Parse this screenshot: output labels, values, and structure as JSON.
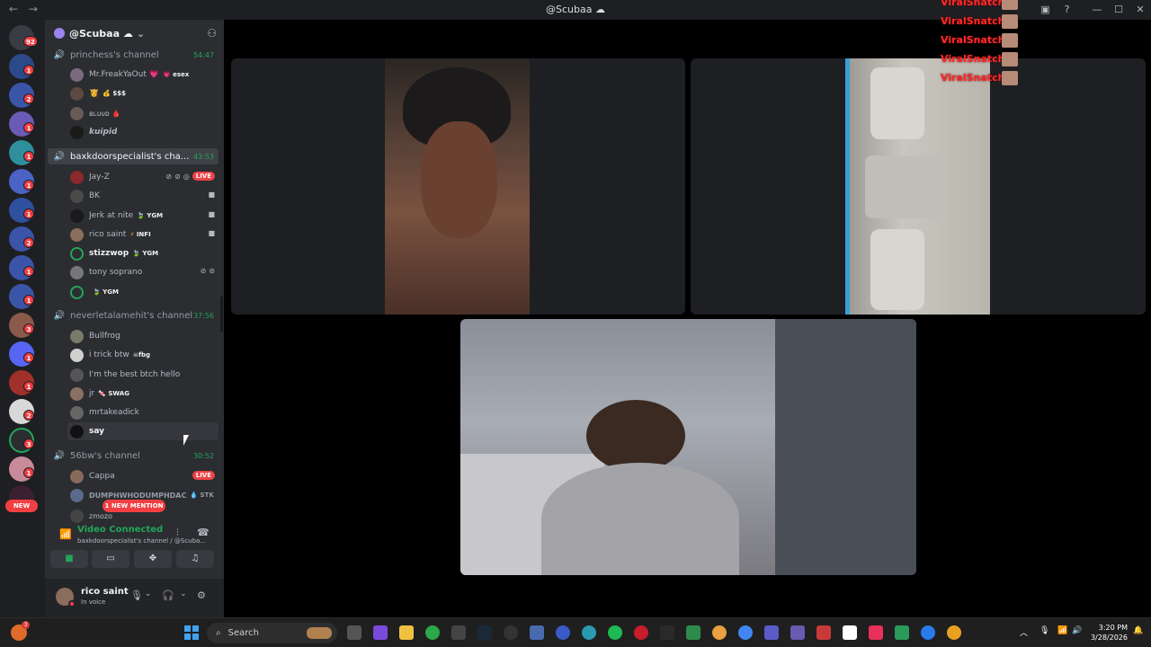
{
  "window": {
    "title": "@Scubaa ☁",
    "nav_back": "←",
    "nav_forward": "→"
  },
  "server_rail": {
    "home_badge": "92",
    "badges": [
      "1",
      "2",
      "1",
      "1",
      "1",
      "1",
      "2",
      "1",
      "1",
      "3",
      "1",
      "1",
      "2",
      "3",
      "1"
    ],
    "new_label": "NEW"
  },
  "server": {
    "name": "@Scubaa ☁"
  },
  "channels": [
    {
      "name": "princhess's channel",
      "duration": "54:47",
      "users": [
        {
          "name": "Mr.FreakYaOut 💗",
          "tag": "esex",
          "tag_emoji": "💗"
        },
        {
          "name": "👸",
          "tag": "$$$",
          "tag_emoji": "💰"
        },
        {
          "name": "ʙʟᴜᴜᴅ 🩸",
          "tag": "",
          "tag_emoji": ""
        },
        {
          "name": "kuipid",
          "tag": "",
          "tag_emoji": ""
        }
      ]
    },
    {
      "name": "baxkdoorspecialist's cha...",
      "duration": "43:53",
      "users": [
        {
          "name": "Jay-Z",
          "tag": "",
          "tag_emoji": "",
          "live": "LIVE"
        },
        {
          "name": "BK",
          "tag": "",
          "tag_emoji": ""
        },
        {
          "name": "Jerk at nite",
          "tag": "YGM",
          "tag_emoji": "🍃"
        },
        {
          "name": "rico saint",
          "tag": "INFI",
          "tag_emoji": "⚡"
        },
        {
          "name": "stizzwop",
          "tag": "YGM",
          "tag_emoji": "🍃"
        },
        {
          "name": "tony soprano",
          "tag": "",
          "tag_emoji": ""
        },
        {
          "name": "",
          "tag": "YGM",
          "tag_emoji": "🍃"
        }
      ]
    },
    {
      "name": "neverletalamehit's channel",
      "duration": "37:56",
      "users": [
        {
          "name": "Bullfrog",
          "tag": "",
          "tag_emoji": ""
        },
        {
          "name": "i trick btw",
          "tag": "fbg",
          "tag_emoji": "☠"
        },
        {
          "name": "I'm the best btch hello",
          "tag": "",
          "tag_emoji": ""
        },
        {
          "name": "jr",
          "tag": "SWAG",
          "tag_emoji": "🍬"
        },
        {
          "name": "mrtakeadick",
          "tag": "",
          "tag_emoji": ""
        },
        {
          "name": "say",
          "tag": "",
          "tag_emoji": ""
        }
      ]
    },
    {
      "name": "56bw's channel",
      "duration": "30:52",
      "users": [
        {
          "name": "Cappa",
          "tag": "",
          "tag_emoji": "",
          "live": "LIVE"
        },
        {
          "name": "DUMPHWHODUMPHDAC",
          "tag": "STK",
          "tag_emoji": "💧"
        },
        {
          "name": "zmozo",
          "tag": "",
          "tag_emoji": ""
        }
      ]
    }
  ],
  "mention_pill": "1 NEW MENTION",
  "voice": {
    "status": "Video Connected",
    "subtitle": "baxkdoorspecialist's channel / @Scuba..."
  },
  "current_user": {
    "name": "rico saint",
    "status": "In voice"
  },
  "overlay": {
    "lines": [
      "ViralSnatch",
      "ViralSnatch",
      "ViralSnatch",
      "ViralSnatch",
      "ViralSnatch"
    ]
  },
  "taskbar": {
    "search_label": "Search",
    "time": "3:20 PM",
    "date": "3/28/2026",
    "notification_badge": "3"
  },
  "colors": {
    "accent_green": "#23a55a",
    "live_red": "#ed4245",
    "overlay_red": "#ff2a2a"
  }
}
